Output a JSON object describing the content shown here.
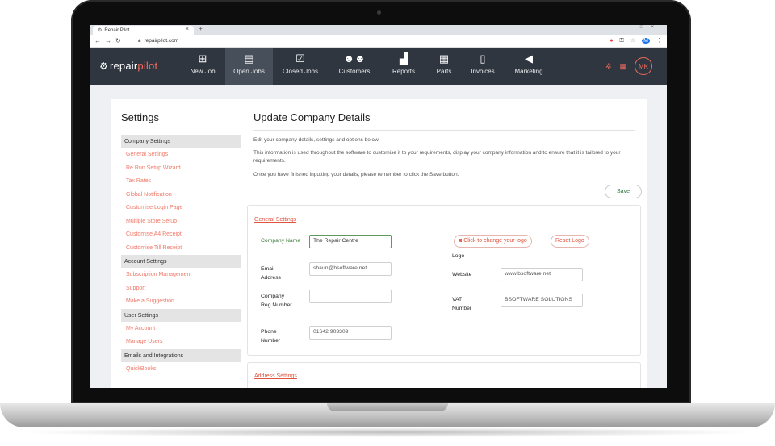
{
  "browser": {
    "tab_title": "Repair Pilot",
    "new_tab": "+",
    "url": "repairpilot.com"
  },
  "app": {
    "logo_repair": "repair",
    "logo_pilot": "pilot",
    "nav": [
      {
        "label": "New Job",
        "icon": "plus-square-icon"
      },
      {
        "label": "Open Jobs",
        "icon": "clipboard-icon"
      },
      {
        "label": "Closed Jobs",
        "icon": "clipboard-check-icon"
      },
      {
        "label": "Customers",
        "icon": "users-icon"
      },
      {
        "label": "Reports",
        "icon": "chart-icon"
      },
      {
        "label": "Parts",
        "icon": "boxes-icon"
      },
      {
        "label": "Invoices",
        "icon": "file-icon"
      },
      {
        "label": "Marketing",
        "icon": "megaphone-icon"
      }
    ],
    "active_nav": "Open Jobs",
    "avatar_initials": "MK",
    "accent_color": "#f26b5b"
  },
  "sidebar": {
    "title": "Settings",
    "groups": [
      {
        "heading": "Company Settings",
        "items": [
          "General Settings",
          "Re Run Setup Wizard",
          "Tax Rates",
          "Global Notification",
          "Customise Login Page",
          "Multiple Store Setup",
          "Customise A4 Receipt",
          "Customise Till Receipt"
        ]
      },
      {
        "heading": "Account Settings",
        "items": [
          "Subscription Management",
          "Support",
          "Make a Suggestion"
        ]
      },
      {
        "heading": "User Settings",
        "items": [
          "My Account",
          "Manage Users"
        ]
      },
      {
        "heading": "Emails and Integrations",
        "items": [
          "QuickBooks"
        ]
      }
    ]
  },
  "main": {
    "title": "Update Company Details",
    "intro1": "Edit your company details, settings and options below.",
    "intro2": "This information is used throughout the software to customise it to your requirements, display your company information and to ensure that it is tailored to your requirements.",
    "intro3": "Once you have finished inputting your details, please remember to click the Save button.",
    "save_label": "Save",
    "general_settings_link": "General Settings",
    "address_settings_link": "Address Settings",
    "fields": {
      "company_name_label": "Company Name",
      "company_name_value": "The Repair Centre",
      "email_label": "Email Address",
      "email_value": "shaun@bsoftware.net",
      "reg_label": "Company Reg Number",
      "reg_value": "",
      "phone_label": "Phone Number",
      "phone_value": "01642 903309",
      "logo_label": "Logo",
      "change_logo": "Click to change your logo",
      "reset_logo": "Reset Logo",
      "website_label": "Website",
      "website_value": "www.bsoftware.net",
      "vat_label": "VAT Number",
      "vat_value": "BSOFTWARE SOLUTIONS"
    }
  }
}
